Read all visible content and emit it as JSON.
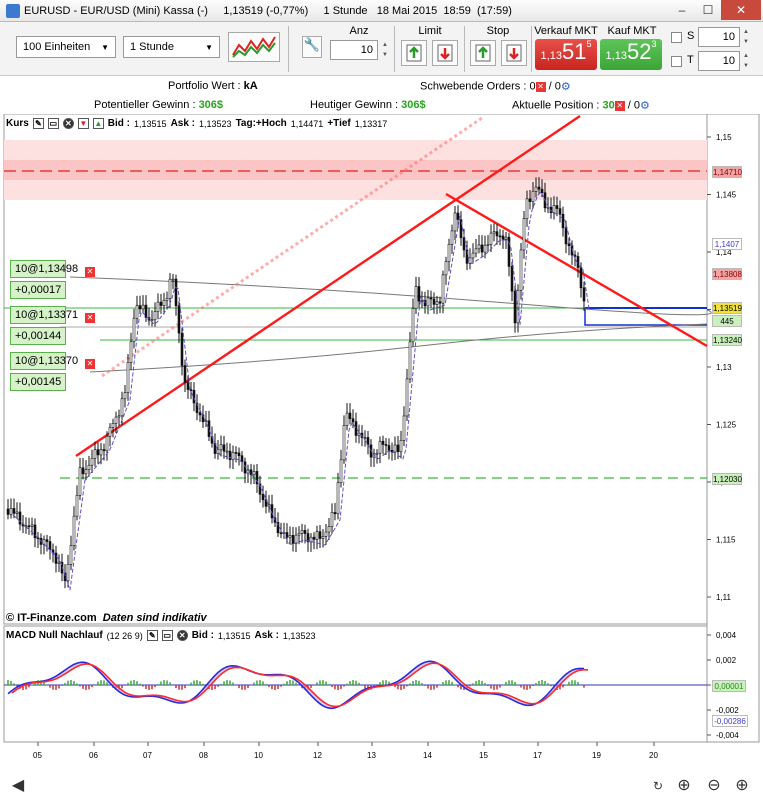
{
  "window": {
    "title": "EURUSD - EUR/USD (Mini) Kassa (-)     1,13519 (-0,77%)     1 Stunde   18 Mai 2015  18:59  (17:59)"
  },
  "toolbar": {
    "units_select": "100 Einheiten",
    "interval_select": "1 Stunde",
    "anz_label": "Anz",
    "anz_value": "10",
    "limit_label": "Limit",
    "stop_label": "Stop",
    "sell": {
      "label": "Verkauf MKT",
      "prefix": "1,13",
      "big": "51",
      "sup": "5"
    },
    "buy": {
      "label": "Kauf MKT",
      "prefix": "1,13",
      "big": "52",
      "sup": "3"
    },
    "s_label": "S",
    "s_value": "10",
    "t_label": "T",
    "t_value": "10"
  },
  "info": {
    "portfolio_label": "Portfolio Wert : ",
    "portfolio_value": "kA",
    "orders_label": "Schwebende Orders : ",
    "orders_value": "0",
    "orders_sep": " / 0",
    "pot_gain_label": "Potentieller Gewinn : ",
    "pot_gain_value": "306$",
    "today_gain_label": "Heutiger Gewinn : ",
    "today_gain_value": "306$",
    "position_label": "Aktuelle Position : ",
    "position_value": "30",
    "position_sep": " / 0"
  },
  "price_panel": {
    "name": "Kurs",
    "bid_label": "Bid : ",
    "bid": "1,13515",
    "ask_label": "Ask : ",
    "ask": "1,13523",
    "tag_label": "Tag:+Hoch",
    "tag_high": "1,14471",
    "tief_label": "+Tief",
    "tag_low": "1,13317"
  },
  "orders": [
    {
      "qty_price": "10@1,13498",
      "diff": "+0,00017"
    },
    {
      "qty_price": "10@1,13371",
      "diff": "+0,00144"
    },
    {
      "qty_price": "10@1,13370",
      "diff": "+0,00145"
    }
  ],
  "price_axis": {
    "ticks": [
      "1,15",
      "1,145",
      "1,14",
      "1,135",
      "1,13",
      "1,125",
      "1,12",
      "1,115",
      "1,11"
    ],
    "tags": [
      {
        "text": "1,14710",
        "bg": "#f2a5a5",
        "color": "#8a0000"
      },
      {
        "text": "1,1407",
        "bg": "#ffffff",
        "color": "#3b3bd0"
      },
      {
        "text": "1,13808",
        "bg": "#f2a5a5",
        "color": "#8a0000"
      },
      {
        "text": "1,13519",
        "bg": "#f1e13a",
        "color": "#000000"
      },
      {
        "text": "445",
        "bg": "#c9f0bd",
        "color": "#000000"
      },
      {
        "text": "1,13240",
        "bg": "#c9f0bd",
        "color": "#000000"
      },
      {
        "text": "1,12030",
        "bg": "#c9f0bd",
        "color": "#000000"
      }
    ]
  },
  "copyright": "© IT-Finanze.com",
  "disclaimer": "Daten sind indikativ",
  "macd_panel": {
    "name": "MACD Null Nachlauf",
    "params": "(12 26 9)",
    "bid_label": "Bid : ",
    "bid": "1,13515",
    "ask_label": "Ask : ",
    "ask": "1,13523",
    "ticks": [
      "0,004",
      "0,002",
      "0",
      "-0,002",
      "-0,004"
    ],
    "tags": [
      {
        "text": "0,00001",
        "bg": "#c9f0bd",
        "color": "#2a8a1a"
      },
      {
        "text": "-0,00286",
        "bg": "#ffffff",
        "color": "#3b3bd0"
      }
    ]
  },
  "time_axis": [
    "05",
    "06",
    "07",
    "08",
    "10",
    "12",
    "13",
    "14",
    "15",
    "17",
    "19",
    "20"
  ],
  "colors": {
    "sell": "#c8241f",
    "buy": "#3aa636",
    "trend": "#ff1a1a",
    "support": "#32c832"
  }
}
